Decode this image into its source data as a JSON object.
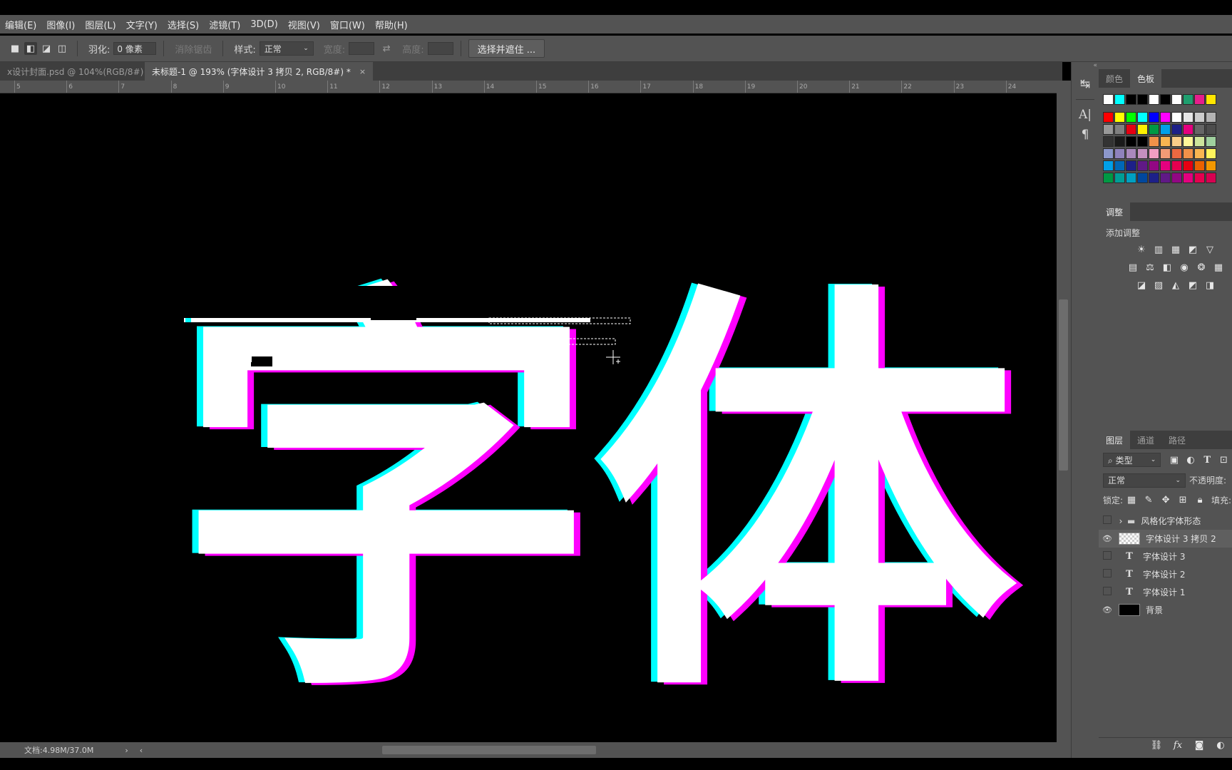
{
  "menu": [
    "编辑(E)",
    "图像(I)",
    "图层(L)",
    "文字(Y)",
    "选择(S)",
    "滤镜(T)",
    "3D(D)",
    "视图(V)",
    "窗口(W)",
    "帮助(H)"
  ],
  "options": {
    "feather_label": "羽化:",
    "feather_value": "0 像素",
    "antialias_label": "消除锯齿",
    "style_label": "样式:",
    "style_value": "正常",
    "width_label": "宽度:",
    "height_label": "高度:",
    "select_mask_button": "选择并遮住 ..."
  },
  "tabs": [
    {
      "label": "x设计封面.psd @ 104%(RGB/8#)",
      "close": "×",
      "active": false
    },
    {
      "label": "未标题-1 @ 193% (字体设计 3 拷贝 2, RGB/8#) *",
      "close": "×",
      "active": true
    }
  ],
  "ruler_ticks": [
    "5",
    "6",
    "7",
    "8",
    "9",
    "10",
    "11",
    "12",
    "13",
    "14",
    "15",
    "16",
    "17",
    "18",
    "19",
    "20",
    "21",
    "22",
    "23",
    "24"
  ],
  "canvas": {
    "text": "字体",
    "fill": "#ffffff",
    "offset_cyan": "#00ffff",
    "offset_magenta": "#ff00ff"
  },
  "status": {
    "doc_info": "文档:4.98M/37.0M",
    "arrow": "›",
    "left_arrow": "‹"
  },
  "right_panel": {
    "color_tabs": [
      "颜色",
      "色板"
    ],
    "swatch_rows": [
      [
        "#ffffff",
        "#00ffff",
        "#000000",
        "#000000",
        "#ffffff",
        "#000000",
        "#ffffff",
        "#1f9f6f",
        "#e61e8c",
        "#ffe600"
      ],
      [
        "#ff0000",
        "#ffff00",
        "#00ff00",
        "#00ffff",
        "#0000ff",
        "#ff00ff",
        "#ffffff",
        "#e6e6e6",
        "#cccccc",
        "#b3b3b3"
      ],
      [
        "#999999",
        "#808080",
        "#e60012",
        "#fff100",
        "#009944",
        "#00a0e9",
        "#1d2088",
        "#e4007f",
        "#666666",
        "#4d4d4d"
      ],
      [
        "#333333",
        "#1a1a1a",
        "#000000",
        "#000000",
        "#f19149",
        "#f8b551",
        "#facd89",
        "#fff799",
        "#cde59b",
        "#9fd09e"
      ],
      [
        "#8c97cb",
        "#8f82bc",
        "#aa89bd",
        "#c490bf",
        "#f19ec2",
        "#f29b76",
        "#ec6941",
        "#f19149",
        "#f8b551",
        "#fff45c"
      ],
      [
        "#00a0e9",
        "#0068b7",
        "#1d2088",
        "#601986",
        "#920783",
        "#e4007f",
        "#e5004f",
        "#e60012",
        "#eb6100",
        "#f39800"
      ],
      [
        "#009944",
        "#009e96",
        "#00a0c1",
        "#00479d",
        "#1d2088",
        "#601986",
        "#920783",
        "#e4007f",
        "#e5004f",
        "#d70051"
      ]
    ],
    "adjust_tab": "调整",
    "adjust_add": "添加调整",
    "adjust_icons_row1": [
      "brightness-icon",
      "levels-icon",
      "curves-icon",
      "exposure-icon",
      "vibrance-icon"
    ],
    "adjust_icons_row2": [
      "hue-saturation-icon",
      "color-balance-icon",
      "black-white-icon",
      "photo-filter-icon",
      "channel-mixer-icon",
      "color-lookup-icon"
    ],
    "adjust_icons_row3": [
      "invert-icon",
      "posterize-icon",
      "threshold-icon",
      "selective-color-icon",
      "gradient-map-icon"
    ],
    "layer_tabs": [
      "图层",
      "通道",
      "路径"
    ],
    "kind_filter": "类型",
    "blend_mode": "正常",
    "opacity_label": "不透明度:",
    "lock_label": "锁定:",
    "fill_label": "填充:",
    "layers": [
      {
        "name": "风格化字体形态",
        "type": "group",
        "visible": false,
        "selected": false
      },
      {
        "name": "字体设计 3 拷贝 2",
        "type": "pixel",
        "visible": true,
        "selected": true
      },
      {
        "name": "字体设计 3",
        "type": "text",
        "visible": false,
        "selected": false
      },
      {
        "name": "字体设计 2",
        "type": "text",
        "visible": false,
        "selected": false
      },
      {
        "name": "字体设计 1",
        "type": "text",
        "visible": false,
        "selected": false
      },
      {
        "name": "背景",
        "type": "background",
        "visible": true,
        "selected": false
      }
    ],
    "footer_icons": [
      "link-icon",
      "fx-icon",
      "mask-icon",
      "adjustment-layer-icon"
    ]
  }
}
